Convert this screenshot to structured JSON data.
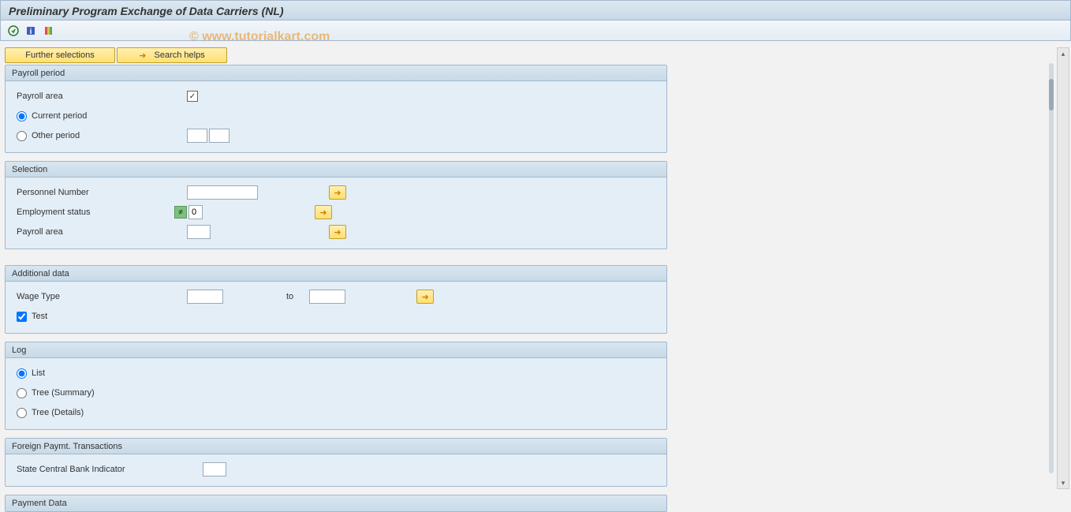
{
  "title": "Preliminary Program Exchange of Data Carriers (NL)",
  "watermark": "© www.tutorialkart.com",
  "buttons": {
    "further_selections": "Further selections",
    "search_helps": "Search helps"
  },
  "groups": {
    "payroll_period": {
      "title": "Payroll period",
      "payroll_area_label": "Payroll area",
      "payroll_area_checked": "✓",
      "current_period_label": "Current period",
      "other_period_label": "Other period",
      "period_radio": "current"
    },
    "selection": {
      "title": "Selection",
      "personnel_number_label": "Personnel Number",
      "personnel_number_value": "",
      "employment_status_label": "Employment status",
      "employment_status_ne": "≠",
      "employment_status_value": "0",
      "payroll_area_label": "Payroll area",
      "payroll_area_value": ""
    },
    "additional_data": {
      "title": "Additional data",
      "wage_type_label": "Wage Type",
      "wage_type_from": "",
      "to_label": "to",
      "wage_type_to": "",
      "test_label": "Test",
      "test_checked": true
    },
    "log": {
      "title": "Log",
      "list_label": "List",
      "tree_summary_label": "Tree (Summary)",
      "tree_details_label": "Tree (Details)",
      "log_radio": "list"
    },
    "foreign_paymt": {
      "title": "Foreign Paymt. Transactions",
      "state_central_bank_label": "State Central Bank Indicator",
      "state_central_bank_value": ""
    },
    "payment_data": {
      "title": "Payment Data"
    }
  }
}
